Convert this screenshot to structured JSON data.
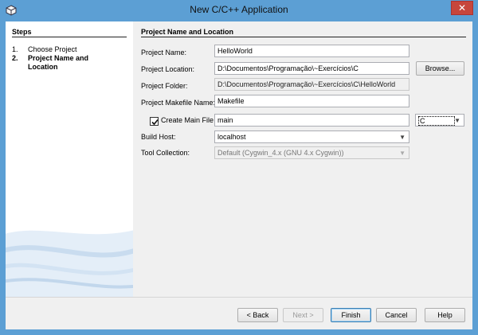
{
  "window": {
    "title": "New C/C++ Application",
    "close_glyph": "✕"
  },
  "steps": {
    "title": "Steps",
    "items": [
      {
        "num": "1.",
        "label": "Choose Project",
        "active": false
      },
      {
        "num": "2.",
        "label": "Project Name and Location",
        "active": true
      }
    ]
  },
  "main": {
    "title": "Project Name and Location",
    "project_name_label": "Project Name:",
    "project_name_value": "HelloWorld",
    "project_location_label": "Project Location:",
    "project_location_value": "D:\\Documentos\\Programação\\~Exercícios\\C",
    "browse_label": "Browse...",
    "project_folder_label": "Project Folder:",
    "project_folder_value": "D:\\Documentos\\Programação\\~Exercícios\\C\\HelloWorld",
    "makefile_label": "Project Makefile Name:",
    "makefile_value": "Makefile",
    "create_main_label": "Create Main File",
    "create_main_checked": true,
    "main_file_value": "main",
    "language_value": "C",
    "build_host_label": "Build Host:",
    "build_host_value": "localhost",
    "tool_collection_label": "Tool Collection:",
    "tool_collection_value": "Default (Cygwin_4.x (GNU 4.x Cygwin))"
  },
  "buttons": {
    "back": "< Back",
    "next": "Next >",
    "finish": "Finish",
    "cancel": "Cancel",
    "help": "Help"
  },
  "colors": {
    "titlebar": "#5c9fd4",
    "close": "#c7463c",
    "panel": "#f0f0f0"
  }
}
